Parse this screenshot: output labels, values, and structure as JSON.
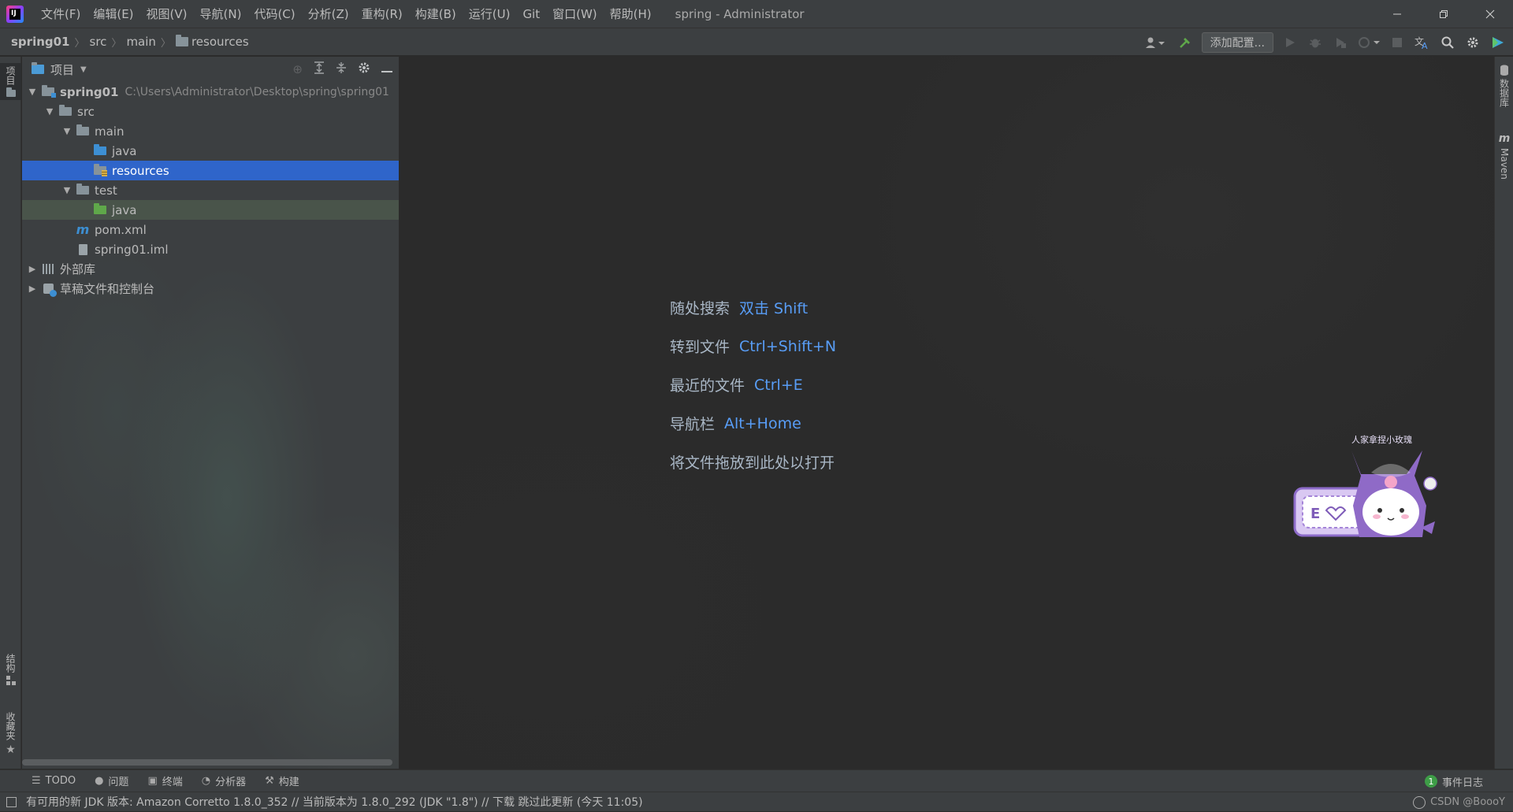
{
  "app": {
    "logo_text": "IJ",
    "window_title": "spring - Administrator"
  },
  "menu": [
    "文件(F)",
    "编辑(E)",
    "视图(V)",
    "导航(N)",
    "代码(C)",
    "分析(Z)",
    "重构(R)",
    "构建(B)",
    "运行(U)",
    "Git",
    "窗口(W)",
    "帮助(H)"
  ],
  "breadcrumb": {
    "root": "spring01",
    "items": [
      "src",
      "main",
      "resources"
    ]
  },
  "nav_tools": {
    "add_config_label": "添加配置..."
  },
  "left_strip": {
    "project_tab": "项目",
    "structure_tab": "结构",
    "favorites_tab": "收藏夹"
  },
  "right_strip": {
    "database_tab": "数据库",
    "maven_tab": "Maven"
  },
  "project_panel": {
    "title": "项目",
    "tree": [
      {
        "label": "spring01",
        "path": "C:\\Users\\Administrator\\Desktop\\spring\\spring01"
      },
      {
        "label": "src"
      },
      {
        "label": "main"
      },
      {
        "label": "java"
      },
      {
        "label": "resources"
      },
      {
        "label": "test"
      },
      {
        "label": "java"
      },
      {
        "label": "pom.xml"
      },
      {
        "label": "spring01.iml"
      },
      {
        "label": "外部库"
      },
      {
        "label": "草稿文件和控制台"
      }
    ]
  },
  "editor": {
    "hints": [
      {
        "label": "随处搜索",
        "key": "双击 Shift"
      },
      {
        "label": "转到文件",
        "key": "Ctrl+Shift+N"
      },
      {
        "label": "最近的文件",
        "key": "Ctrl+E"
      },
      {
        "label": "导航栏",
        "key": "Alt+Home"
      }
    ],
    "drop_hint": "将文件拖放到此处以打开",
    "sticker_text": "人家拿捏小玫瑰"
  },
  "bottom_tabs": [
    {
      "label": "TODO",
      "icon": "list-icon"
    },
    {
      "label": "问题",
      "icon": "problems-icon"
    },
    {
      "label": "终端",
      "icon": "terminal-icon"
    },
    {
      "label": "分析器",
      "icon": "profiler-icon"
    },
    {
      "label": "构建",
      "icon": "hammer-icon"
    }
  ],
  "event_log": {
    "count": "1",
    "label": "事件日志"
  },
  "status": {
    "message": "有可用的新 JDK 版本: Amazon Corretto 1.8.0_352 // 当前版本为 1.8.0_292 (JDK \"1.8\") // 下载   跳过此更新 (今天 11:05)",
    "right_text": "CSDN @BoooY"
  },
  "colors": {
    "accent": "#2f65ca",
    "link": "#589df6",
    "panel": "#3c3f41",
    "editor": "#2b2b2b"
  }
}
